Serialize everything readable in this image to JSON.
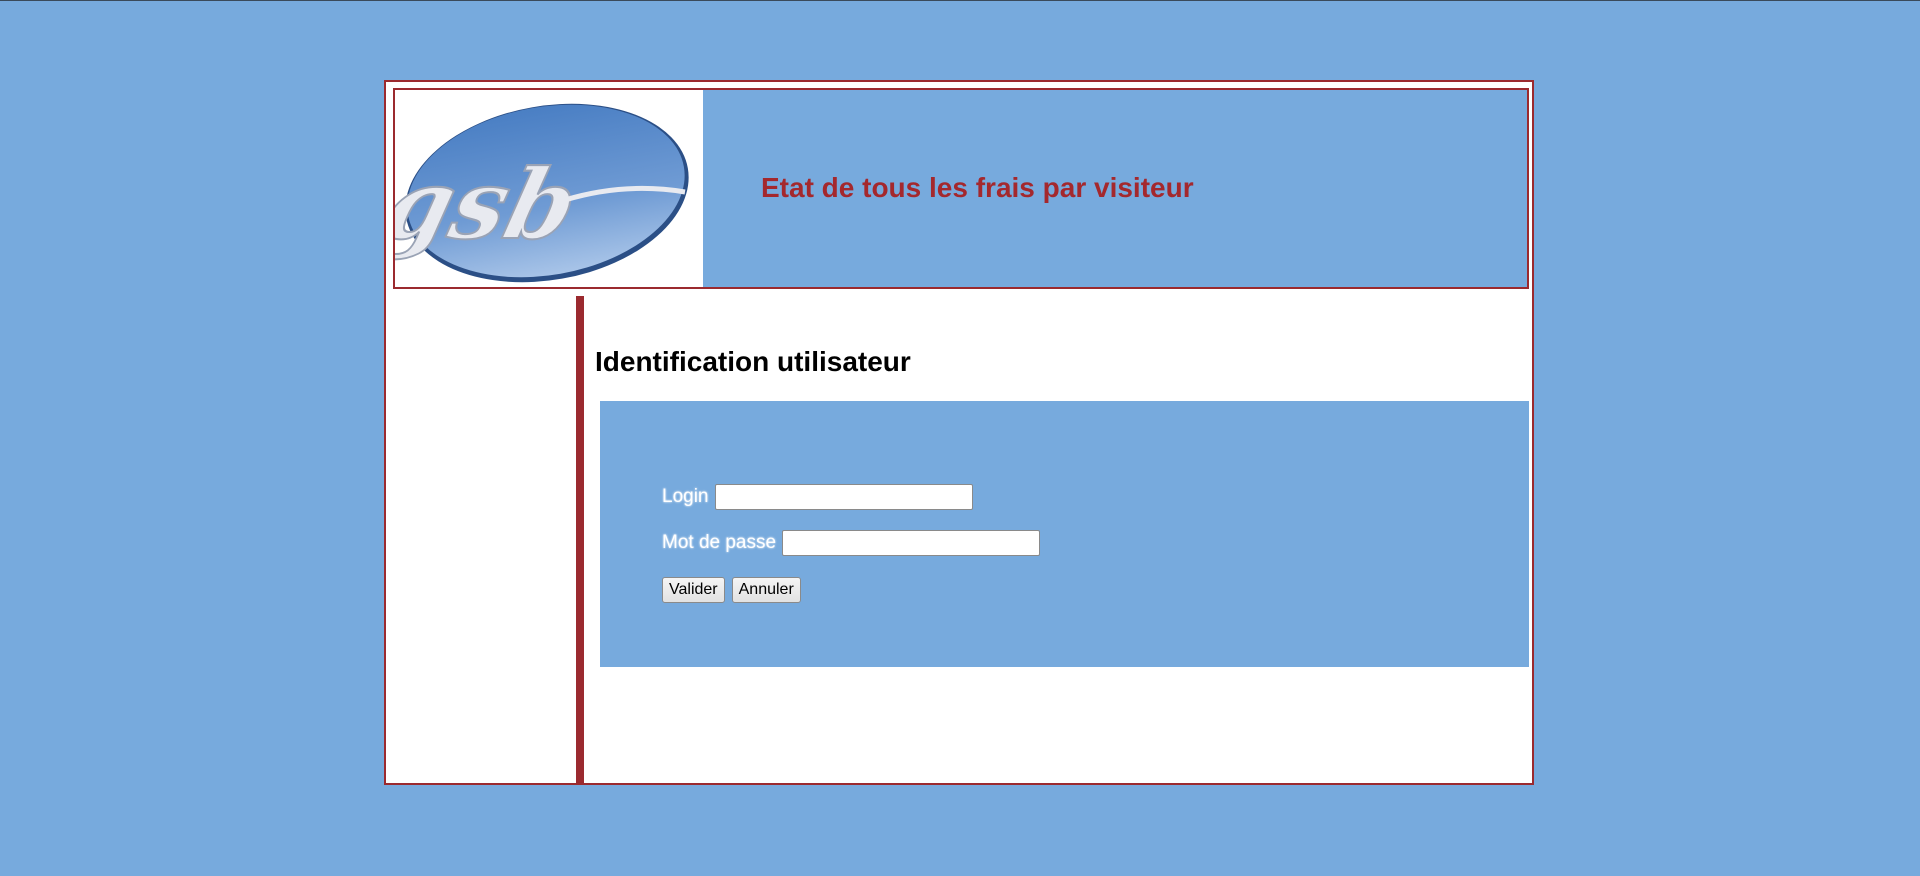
{
  "header": {
    "logo_text": "gsb",
    "title": "Etat de tous les frais par visiteur"
  },
  "content": {
    "title": "Identification utilisateur"
  },
  "login_form": {
    "login_label": "Login",
    "login_value": "",
    "password_label": "Mot de passe",
    "password_value": "",
    "submit_label": "Valider",
    "cancel_label": "Annuler"
  },
  "colors": {
    "background": "#77aadd",
    "accent": "#9b2a2f",
    "title_text": "#a4282d"
  }
}
